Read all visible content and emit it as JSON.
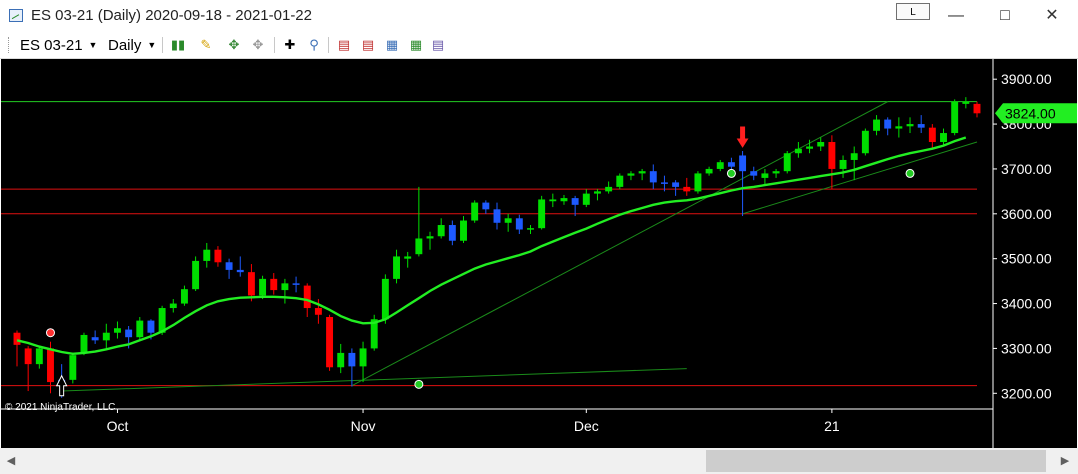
{
  "window": {
    "title": "ES 03-21 (Daily)  2020-09-18 - 2021-01-22",
    "link_button": "L",
    "minimize_icon": "minimize-icon",
    "maximize_icon": "maximize-icon",
    "close_icon": "close-icon"
  },
  "toolbar": {
    "instrument": "ES 03-21",
    "interval": "Daily",
    "icons": [
      "bar-type-icon",
      "drawing-tool-icon",
      "global-draw-icon",
      "hide-draw-icon",
      "crosshair-icon",
      "zoom-icon",
      "indicators-icon",
      "strategies-icon",
      "chart-trader-icon",
      "properties-icon"
    ]
  },
  "colors": {
    "background": "#000000",
    "up_candle": "#00e000",
    "down_candle": "#ff0000",
    "neutral_candle": "#1e5aff",
    "moving_average": "#22ee22",
    "price_marker": "#22ee22",
    "horizontal_lines": "#e01010",
    "trend_lines": "#1a8a1a",
    "axis_text": "#ffffff"
  },
  "chart_data": {
    "type": "candlestick",
    "instrument": "ES 03-21",
    "interval": "Daily",
    "range": [
      "2020-09-18",
      "2021-01-22"
    ],
    "copyright": "© 2021 NinjaTrader, LLC",
    "ylim": [
      3165,
      3945
    ],
    "y_ticks": [
      3900,
      3800,
      3700,
      3600,
      3500,
      3400,
      3300,
      3200
    ],
    "y_tick_labels": [
      "3900.00",
      "3800.00",
      "3700.00",
      "3600.00",
      "3500.00",
      "3400.00",
      "3300.00",
      "3200.00"
    ],
    "x_tick_labels": [
      {
        "label": "Oct",
        "date": "2020-10-01"
      },
      {
        "label": "Nov",
        "date": "2020-11-02"
      },
      {
        "label": "Dec",
        "date": "2020-12-01"
      },
      {
        "label": "21",
        "date": "2021-01-04"
      }
    ],
    "last_price": 3824.0,
    "last_price_label": "3824.00",
    "candles": [
      {
        "d": "2020-09-18",
        "o": 3335,
        "h": 3340,
        "l": 3260,
        "c": 3308,
        "t": "down"
      },
      {
        "d": "2020-09-21",
        "o": 3300,
        "h": 3305,
        "l": 3205,
        "c": 3265,
        "t": "down"
      },
      {
        "d": "2020-09-22",
        "o": 3265,
        "h": 3305,
        "l": 3255,
        "c": 3300,
        "t": "up"
      },
      {
        "d": "2020-09-23",
        "o": 3300,
        "h": 3315,
        "l": 3200,
        "c": 3225,
        "t": "down"
      },
      {
        "d": "2020-09-24",
        "o": 3220,
        "h": 3265,
        "l": 3190,
        "c": 3230,
        "t": "neutral"
      },
      {
        "d": "2020-09-25",
        "o": 3230,
        "h": 3290,
        "l": 3222,
        "c": 3285,
        "t": "up"
      },
      {
        "d": "2020-09-28",
        "o": 3290,
        "h": 3335,
        "l": 3285,
        "c": 3330,
        "t": "up"
      },
      {
        "d": "2020-09-29",
        "o": 3325,
        "h": 3340,
        "l": 3310,
        "c": 3318,
        "t": "neutral"
      },
      {
        "d": "2020-09-30",
        "o": 3318,
        "h": 3355,
        "l": 3300,
        "c": 3335,
        "t": "up"
      },
      {
        "d": "2020-10-01",
        "o": 3335,
        "h": 3360,
        "l": 3322,
        "c": 3345,
        "t": "up"
      },
      {
        "d": "2020-10-02",
        "o": 3342,
        "h": 3350,
        "l": 3300,
        "c": 3325,
        "t": "neutral"
      },
      {
        "d": "2020-10-05",
        "o": 3325,
        "h": 3370,
        "l": 3320,
        "c": 3362,
        "t": "up"
      },
      {
        "d": "2020-10-06",
        "o": 3362,
        "h": 3365,
        "l": 3320,
        "c": 3335,
        "t": "neutral"
      },
      {
        "d": "2020-10-07",
        "o": 3335,
        "h": 3395,
        "l": 3330,
        "c": 3390,
        "t": "up"
      },
      {
        "d": "2020-10-08",
        "o": 3390,
        "h": 3410,
        "l": 3380,
        "c": 3400,
        "t": "up"
      },
      {
        "d": "2020-10-09",
        "o": 3400,
        "h": 3440,
        "l": 3395,
        "c": 3432,
        "t": "up"
      },
      {
        "d": "2020-10-12",
        "o": 3432,
        "h": 3505,
        "l": 3428,
        "c": 3495,
        "t": "up"
      },
      {
        "d": "2020-10-13",
        "o": 3495,
        "h": 3535,
        "l": 3480,
        "c": 3520,
        "t": "up"
      },
      {
        "d": "2020-10-14",
        "o": 3520,
        "h": 3528,
        "l": 3482,
        "c": 3492,
        "t": "down"
      },
      {
        "d": "2020-10-15",
        "o": 3492,
        "h": 3500,
        "l": 3455,
        "c": 3475,
        "t": "neutral"
      },
      {
        "d": "2020-10-16",
        "o": 3475,
        "h": 3505,
        "l": 3460,
        "c": 3470,
        "t": "neutral"
      },
      {
        "d": "2020-10-19",
        "o": 3470,
        "h": 3488,
        "l": 3405,
        "c": 3418,
        "t": "down"
      },
      {
        "d": "2020-10-20",
        "o": 3418,
        "h": 3462,
        "l": 3410,
        "c": 3455,
        "t": "up"
      },
      {
        "d": "2020-10-21",
        "o": 3455,
        "h": 3468,
        "l": 3420,
        "c": 3430,
        "t": "down"
      },
      {
        "d": "2020-10-22",
        "o": 3430,
        "h": 3455,
        "l": 3400,
        "c": 3445,
        "t": "up"
      },
      {
        "d": "2020-10-23",
        "o": 3445,
        "h": 3460,
        "l": 3425,
        "c": 3445,
        "t": "neutral"
      },
      {
        "d": "2020-10-26",
        "o": 3440,
        "h": 3445,
        "l": 3370,
        "c": 3390,
        "t": "down"
      },
      {
        "d": "2020-10-27",
        "o": 3390,
        "h": 3410,
        "l": 3355,
        "c": 3375,
        "t": "down"
      },
      {
        "d": "2020-10-28",
        "o": 3370,
        "h": 3375,
        "l": 3250,
        "c": 3258,
        "t": "down"
      },
      {
        "d": "2020-10-29",
        "o": 3258,
        "h": 3310,
        "l": 3245,
        "c": 3290,
        "t": "up"
      },
      {
        "d": "2020-10-30",
        "o": 3290,
        "h": 3300,
        "l": 3215,
        "c": 3260,
        "t": "neutral"
      },
      {
        "d": "2020-11-02",
        "o": 3260,
        "h": 3315,
        "l": 3225,
        "c": 3300,
        "t": "up"
      },
      {
        "d": "2020-11-03",
        "o": 3300,
        "h": 3375,
        "l": 3295,
        "c": 3365,
        "t": "up"
      },
      {
        "d": "2020-11-04",
        "o": 3365,
        "h": 3465,
        "l": 3355,
        "c": 3455,
        "t": "up"
      },
      {
        "d": "2020-11-05",
        "o": 3455,
        "h": 3520,
        "l": 3445,
        "c": 3505,
        "t": "up"
      },
      {
        "d": "2020-11-06",
        "o": 3505,
        "h": 3515,
        "l": 3480,
        "c": 3500,
        "t": "up"
      },
      {
        "d": "2020-11-09",
        "o": 3510,
        "h": 3660,
        "l": 3505,
        "c": 3545,
        "t": "up"
      },
      {
        "d": "2020-11-10",
        "o": 3545,
        "h": 3560,
        "l": 3520,
        "c": 3550,
        "t": "up"
      },
      {
        "d": "2020-11-11",
        "o": 3550,
        "h": 3590,
        "l": 3545,
        "c": 3575,
        "t": "up"
      },
      {
        "d": "2020-11-12",
        "o": 3575,
        "h": 3585,
        "l": 3530,
        "c": 3540,
        "t": "neutral"
      },
      {
        "d": "2020-11-13",
        "o": 3540,
        "h": 3595,
        "l": 3535,
        "c": 3585,
        "t": "up"
      },
      {
        "d": "2020-11-16",
        "o": 3585,
        "h": 3630,
        "l": 3580,
        "c": 3625,
        "t": "up"
      },
      {
        "d": "2020-11-17",
        "o": 3625,
        "h": 3630,
        "l": 3600,
        "c": 3610,
        "t": "neutral"
      },
      {
        "d": "2020-11-18",
        "o": 3610,
        "h": 3625,
        "l": 3565,
        "c": 3580,
        "t": "neutral"
      },
      {
        "d": "2020-11-19",
        "o": 3580,
        "h": 3600,
        "l": 3560,
        "c": 3590,
        "t": "up"
      },
      {
        "d": "2020-11-20",
        "o": 3590,
        "h": 3598,
        "l": 3555,
        "c": 3565,
        "t": "neutral"
      },
      {
        "d": "2020-11-23",
        "o": 3565,
        "h": 3575,
        "l": 3555,
        "c": 3568,
        "t": "up"
      },
      {
        "d": "2020-11-24",
        "o": 3568,
        "h": 3640,
        "l": 3565,
        "c": 3632,
        "t": "up"
      },
      {
        "d": "2020-11-25",
        "o": 3632,
        "h": 3645,
        "l": 3615,
        "c": 3628,
        "t": "up"
      },
      {
        "d": "2020-11-27",
        "o": 3628,
        "h": 3642,
        "l": 3620,
        "c": 3635,
        "t": "up"
      },
      {
        "d": "2020-11-30",
        "o": 3635,
        "h": 3640,
        "l": 3595,
        "c": 3620,
        "t": "neutral"
      },
      {
        "d": "2020-12-01",
        "o": 3620,
        "h": 3655,
        "l": 3615,
        "c": 3645,
        "t": "up"
      },
      {
        "d": "2020-12-02",
        "o": 3645,
        "h": 3655,
        "l": 3630,
        "c": 3650,
        "t": "up"
      },
      {
        "d": "2020-12-03",
        "o": 3650,
        "h": 3672,
        "l": 3645,
        "c": 3660,
        "t": "up"
      },
      {
        "d": "2020-12-04",
        "o": 3660,
        "h": 3690,
        "l": 3655,
        "c": 3685,
        "t": "up"
      },
      {
        "d": "2020-12-07",
        "o": 3685,
        "h": 3695,
        "l": 3675,
        "c": 3690,
        "t": "up"
      },
      {
        "d": "2020-12-08",
        "o": 3690,
        "h": 3700,
        "l": 3675,
        "c": 3695,
        "t": "up"
      },
      {
        "d": "2020-12-09",
        "o": 3695,
        "h": 3710,
        "l": 3655,
        "c": 3670,
        "t": "neutral"
      },
      {
        "d": "2020-12-10",
        "o": 3670,
        "h": 3685,
        "l": 3650,
        "c": 3670,
        "t": "neutral"
      },
      {
        "d": "2020-12-11",
        "o": 3670,
        "h": 3675,
        "l": 3640,
        "c": 3660,
        "t": "neutral"
      },
      {
        "d": "2020-12-14",
        "o": 3660,
        "h": 3680,
        "l": 3640,
        "c": 3650,
        "t": "down"
      },
      {
        "d": "2020-12-15",
        "o": 3650,
        "h": 3695,
        "l": 3645,
        "c": 3690,
        "t": "up"
      },
      {
        "d": "2020-12-16",
        "o": 3690,
        "h": 3705,
        "l": 3685,
        "c": 3700,
        "t": "up"
      },
      {
        "d": "2020-12-17",
        "o": 3700,
        "h": 3720,
        "l": 3695,
        "c": 3715,
        "t": "up"
      },
      {
        "d": "2020-12-18",
        "o": 3715,
        "h": 3725,
        "l": 3700,
        "c": 3705,
        "t": "neutral"
      },
      {
        "d": "2020-12-21",
        "o": 3730,
        "h": 3740,
        "l": 3595,
        "c": 3695,
        "t": "neutral"
      },
      {
        "d": "2020-12-22",
        "o": 3695,
        "h": 3705,
        "l": 3675,
        "c": 3685,
        "t": "neutral"
      },
      {
        "d": "2020-12-23",
        "o": 3680,
        "h": 3700,
        "l": 3665,
        "c": 3690,
        "t": "up"
      },
      {
        "d": "2020-12-24",
        "o": 3690,
        "h": 3700,
        "l": 3680,
        "c": 3695,
        "t": "up"
      },
      {
        "d": "2020-12-28",
        "o": 3695,
        "h": 3740,
        "l": 3690,
        "c": 3735,
        "t": "up"
      },
      {
        "d": "2020-12-29",
        "o": 3735,
        "h": 3760,
        "l": 3725,
        "c": 3745,
        "t": "up"
      },
      {
        "d": "2020-12-30",
        "o": 3745,
        "h": 3765,
        "l": 3735,
        "c": 3750,
        "t": "up"
      },
      {
        "d": "2020-12-31",
        "o": 3750,
        "h": 3770,
        "l": 3740,
        "c": 3760,
        "t": "up"
      },
      {
        "d": "2021-01-04",
        "o": 3760,
        "h": 3775,
        "l": 3655,
        "c": 3700,
        "t": "down"
      },
      {
        "d": "2021-01-05",
        "o": 3700,
        "h": 3730,
        "l": 3680,
        "c": 3720,
        "t": "up"
      },
      {
        "d": "2021-01-06",
        "o": 3720,
        "h": 3750,
        "l": 3675,
        "c": 3735,
        "t": "up"
      },
      {
        "d": "2021-01-07",
        "o": 3735,
        "h": 3790,
        "l": 3730,
        "c": 3785,
        "t": "up"
      },
      {
        "d": "2021-01-08",
        "o": 3785,
        "h": 3820,
        "l": 3775,
        "c": 3810,
        "t": "up"
      },
      {
        "d": "2021-01-11",
        "o": 3810,
        "h": 3815,
        "l": 3775,
        "c": 3790,
        "t": "neutral"
      },
      {
        "d": "2021-01-12",
        "o": 3790,
        "h": 3815,
        "l": 3770,
        "c": 3795,
        "t": "up"
      },
      {
        "d": "2021-01-13",
        "o": 3795,
        "h": 3815,
        "l": 3780,
        "c": 3800,
        "t": "up"
      },
      {
        "d": "2021-01-14",
        "o": 3800,
        "h": 3820,
        "l": 3780,
        "c": 3792,
        "t": "neutral"
      },
      {
        "d": "2021-01-15",
        "o": 3792,
        "h": 3800,
        "l": 3745,
        "c": 3760,
        "t": "down"
      },
      {
        "d": "2021-01-19",
        "o": 3760,
        "h": 3790,
        "l": 3750,
        "c": 3780,
        "t": "up"
      },
      {
        "d": "2021-01-20",
        "o": 3780,
        "h": 3855,
        "l": 3775,
        "c": 3850,
        "t": "up"
      },
      {
        "d": "2021-01-21",
        "o": 3850,
        "h": 3860,
        "l": 3835,
        "c": 3845,
        "t": "up"
      },
      {
        "d": "2021-01-22",
        "o": 3845,
        "h": 3850,
        "l": 3815,
        "c": 3824,
        "t": "down"
      }
    ],
    "moving_average": [
      3318,
      3312,
      3304,
      3298,
      3292,
      3288,
      3290,
      3293,
      3298,
      3304,
      3309,
      3318,
      3327,
      3338,
      3352,
      3368,
      3383,
      3396,
      3405,
      3410,
      3413,
      3414,
      3415,
      3415,
      3414,
      3412,
      3408,
      3398,
      3386,
      3372,
      3362,
      3356,
      3357,
      3365,
      3380,
      3396,
      3412,
      3428,
      3442,
      3454,
      3466,
      3478,
      3487,
      3494,
      3501,
      3508,
      3516,
      3528,
      3538,
      3548,
      3558,
      3567,
      3578,
      3588,
      3598,
      3606,
      3613,
      3620,
      3625,
      3628,
      3630,
      3634,
      3640,
      3646,
      3652,
      3657,
      3660,
      3664,
      3668,
      3672,
      3676,
      3680,
      3684,
      3688,
      3692,
      3698,
      3706,
      3714,
      3722,
      3729,
      3735,
      3740,
      3745,
      3752,
      3762,
      3770
    ],
    "horizontal_levels": [
      3850,
      3655,
      3600,
      3217
    ],
    "signal_arrows": [
      {
        "d": "2020-09-24",
        "dir": "up",
        "color": "#00cc00"
      },
      {
        "d": "2020-12-21",
        "dir": "down",
        "color": "#ff2020"
      }
    ],
    "signal_dots": [
      {
        "d": "2020-09-23",
        "price": 3335,
        "color": "#ff3030"
      },
      {
        "d": "2020-11-09",
        "price": 3220,
        "color": "#22cc22"
      },
      {
        "d": "2020-12-18",
        "price": 3690,
        "color": "#22cc22"
      },
      {
        "d": "2021-01-13",
        "price": 3690,
        "color": "#22cc22"
      }
    ],
    "trend_lines": [
      {
        "from": {
          "d": "2020-10-30",
          "price": 3217
        },
        "to": {
          "d": "2021-01-11",
          "price": 3850
        }
      },
      {
        "from": {
          "d": "2020-09-24",
          "price": 3205
        },
        "to": {
          "d": "2020-12-14",
          "price": 3255
        }
      },
      {
        "from": {
          "d": "2020-12-21",
          "price": 3600
        },
        "to": {
          "d": "2021-01-22",
          "price": 3760
        }
      }
    ]
  }
}
